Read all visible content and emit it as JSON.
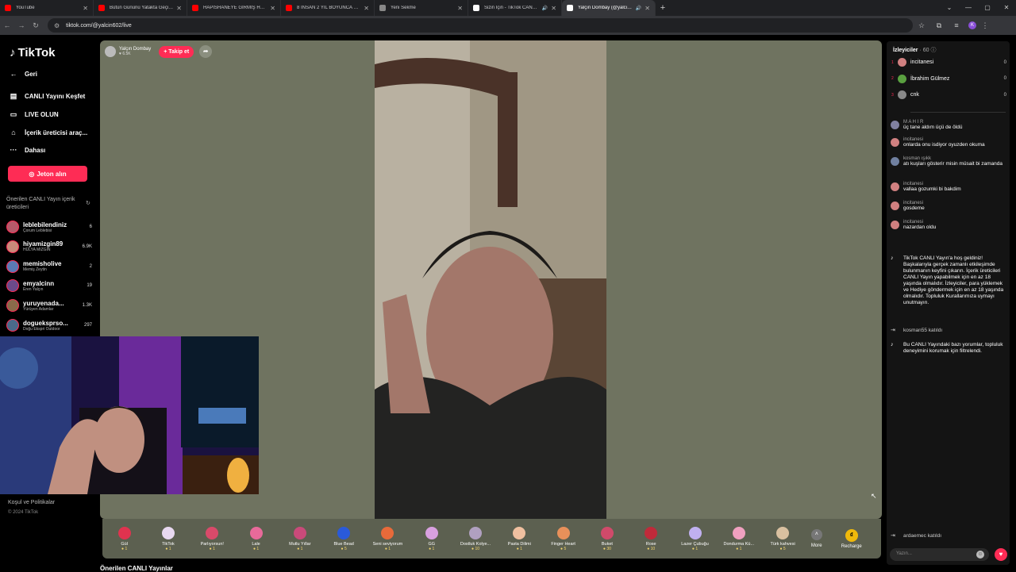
{
  "browser": {
    "tabs": [
      {
        "title": "YouTube",
        "color": "#ff0000",
        "speaker": false
      },
      {
        "title": "Bütün Gününü Yatakta Geçiriyor",
        "color": "#ff0000",
        "speaker": false
      },
      {
        "title": "HAPİSHANEYE GİRMİŞ HANIM",
        "color": "#ff0000",
        "speaker": false
      },
      {
        "title": "8 İNSAN 2 YIL BOYUNCA BİR ...",
        "color": "#ff0000",
        "speaker": false
      },
      {
        "title": "Yeni Sekme",
        "color": "#888888",
        "speaker": false
      },
      {
        "title": "Sizin İçin - TikTok CANLI Yayın",
        "color": "#ffffff",
        "speaker": true
      },
      {
        "title": "Yalçın Dombay (@yalcin602)",
        "color": "#ffffff",
        "speaker": true,
        "active": true
      }
    ],
    "url": "tiktok.com/@yalcin602/live"
  },
  "sidebar": {
    "logo": "TikTok",
    "nav": [
      {
        "label": "Geri",
        "icon": "←"
      },
      {
        "label": "CANLI Yayını Keşfet",
        "icon": "▤"
      },
      {
        "label": "LIVE OLUN",
        "icon": "▭"
      },
      {
        "label": "İçerik üreticisi araç...",
        "icon": "⌂"
      },
      {
        "label": "Dahası",
        "icon": "···"
      }
    ],
    "joton": "Jeton alın",
    "recommended_title": "Önerilen CANLI Yayın içerik üreticileri",
    "creators": [
      {
        "name": "leblebilendiniz",
        "sub": "Çorum Leblebisi",
        "count": "6",
        "color": "#b55a6a"
      },
      {
        "name": "hiyamizgin89",
        "sub": "HÜLYA MIZGIN",
        "count": "6.9K",
        "color": "#c98a7a"
      },
      {
        "name": "memisholive",
        "sub": "Memiş Zeytin",
        "count": "2",
        "color": "#5a7ab5"
      },
      {
        "name": "emyalcinn",
        "sub": "Eren Yalçın",
        "count": "19",
        "color": "#6b4a8a"
      },
      {
        "name": "yuruyenada...",
        "sub": "Yürüyen Adamlar",
        "count": "1.3K",
        "color": "#8a6a4a"
      },
      {
        "name": "dogueksprso...",
        "sub": "Doğu Ekspri Outdoor",
        "count": "297",
        "color": "#4a6a8a"
      }
    ],
    "footer1": "Koşul ve Politikalar",
    "footer2": "© 2024 TikTok"
  },
  "stream": {
    "host_name": "Yalçın Dombay",
    "host_likes": "♥ 6.5K",
    "follow": "+ Takip et"
  },
  "gifts": [
    {
      "name": "Gül",
      "price": "1",
      "color": "#e0334f"
    },
    {
      "name": "TikTok",
      "price": "1",
      "color": "#e8d8f0"
    },
    {
      "name": "Parlıyorsun!",
      "price": "1",
      "color": "#d94a6a"
    },
    {
      "name": "Lale",
      "price": "1",
      "color": "#e86a9a"
    },
    {
      "name": "Mutlu Yıllar",
      "price": "1",
      "color": "#c94a7a"
    },
    {
      "name": "Blue Bead",
      "price": "5",
      "color": "#2a5ad9"
    },
    {
      "name": "Seni seviyorum",
      "price": "1",
      "color": "#e86a3a"
    },
    {
      "name": "GG",
      "price": "1",
      "color": "#d9a0e0"
    },
    {
      "name": "Dostluk Kolye...",
      "price": "10",
      "color": "#b0a0c0"
    },
    {
      "name": "Pasta Dilimi",
      "price": "1",
      "color": "#f0c0a0"
    },
    {
      "name": "Finger Heart",
      "price": "5",
      "color": "#e8905a"
    },
    {
      "name": "Buket",
      "price": "30",
      "color": "#d04a6a"
    },
    {
      "name": "Rose",
      "price": "10",
      "color": "#c02a3a"
    },
    {
      "name": "Lazer Çubuğu",
      "price": "1",
      "color": "#c0b0f0"
    },
    {
      "name": "Dondurma Kü...",
      "price": "1",
      "color": "#f0a0c0"
    },
    {
      "name": "Türk kahvesi",
      "price": "5",
      "color": "#d9c0a0"
    }
  ],
  "gift_more": "More",
  "gift_recharge": "Recharge",
  "bottom_title": "Önerilen CANLI Yayınlar",
  "chat": {
    "viewers_title": "İzleyiciler",
    "viewers_count": "· 60",
    "viewers": [
      {
        "rank": "1",
        "name": "incitanesi",
        "score": "0",
        "color": "#d08080"
      },
      {
        "rank": "2",
        "name": "İbrahim Gülmez",
        "score": "0",
        "color": "#5aa040"
      },
      {
        "rank": "3",
        "name": "cnk",
        "score": "0",
        "color": "#888888"
      }
    ],
    "messages": [
      {
        "user": "M A H I R",
        "text": "üç tane aldım üçü de öldü",
        "color": "#8080a0"
      },
      {
        "user": "incitanesi",
        "text": "onlarda onu isdiyor oyuzden okuma",
        "color": "#d08080"
      },
      {
        "user": "kosman ışıkk",
        "text": "atı kuşları gösterir misin müsait bi zamanda",
        "color": "#7080a0"
      },
      {
        "user": "incitanesi",
        "text": "vallaa gozumki bi bakdim",
        "color": "#d08080"
      },
      {
        "user": "incitanesi",
        "text": "gosdeme",
        "color": "#d08080"
      },
      {
        "user": "incitanesi",
        "text": "nazardan oldu",
        "color": "#d08080"
      }
    ],
    "system1": "TikTok CANLI Yayın'a hoş geldiniz! Başkalarıyla gerçek zamanlı etkileşimde bulunmanın keyfini çıkarın. İçerik üreticileri CANLI Yayın yapabilmek için en az 18 yaşında olmalıdır. İzleyiciler, para yüklemek ve Hediye göndermek için en az 18 yaşında olmalıdır. Topluluk Kurallarımıza uymayı unutmayın.",
    "joined1": "kosman55 katıldı",
    "system2": "Bu CANLI Yayındaki bazı yorumlar, topluluk deneyimini korumak için filtrelendi.",
    "joined2": "ardaemec katıldı",
    "input_placeholder": "Yazın..."
  }
}
